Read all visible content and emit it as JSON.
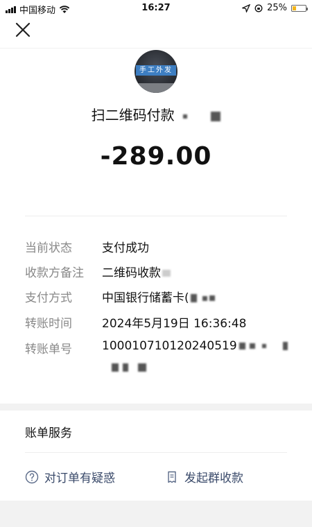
{
  "status_bar": {
    "carrier": "中国移动",
    "time": "16:27",
    "battery": "25%",
    "battery_level": 0.25
  },
  "header": {
    "avatar_sign": "手工外发"
  },
  "payment": {
    "merchant": "扫二维码付款",
    "amount": "-289.00"
  },
  "details": [
    {
      "label": "当前状态",
      "value": "支付成功"
    },
    {
      "label": "收款方备注",
      "value": "二维码收款"
    },
    {
      "label": "支付方式",
      "value": "中国银行储蓄卡("
    },
    {
      "label": "转账时间",
      "value": "2024年5月19日 16:36:48"
    },
    {
      "label": "转账单号",
      "value": "100010710120240519"
    }
  ],
  "services": {
    "title": "账单服务",
    "question_label": "对订单有疑惑",
    "group_collect_label": "发起群收款"
  },
  "colors": {
    "link": "#3a4a6a",
    "label": "#888888",
    "band": "#f2f2f2"
  }
}
